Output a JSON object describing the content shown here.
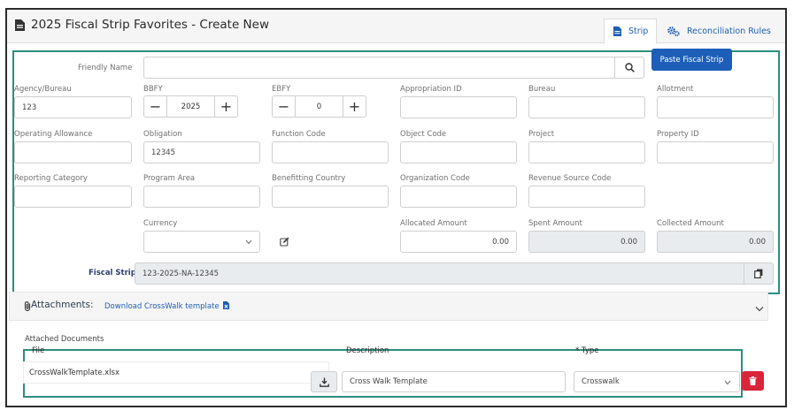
{
  "header": {
    "title": "2025 Fiscal Strip Favorites - Create New",
    "tabs": [
      {
        "label": "Strip",
        "icon": "document-icon",
        "active": true
      },
      {
        "label": "Reconciliation Rules",
        "icon": "gears-icon",
        "active": false
      }
    ]
  },
  "form": {
    "friendly_name": {
      "label": "Friendly Name",
      "value": ""
    },
    "paste_label": "Paste Fiscal Strip",
    "fields": {
      "agency_bureau": {
        "label": "Agency/Bureau",
        "value": "123"
      },
      "bbfy": {
        "label": "BBFY",
        "value": "2025"
      },
      "ebfy": {
        "label": "EBFY",
        "value": "0"
      },
      "appropriation_id": {
        "label": "Appropriation ID",
        "value": ""
      },
      "bureau": {
        "label": "Bureau",
        "value": ""
      },
      "allotment": {
        "label": "Allotment",
        "value": ""
      },
      "operating_allowance": {
        "label": "Operating Allowance",
        "value": ""
      },
      "obligation": {
        "label": "Obligation",
        "value": "12345"
      },
      "function_code": {
        "label": "Function Code",
        "value": ""
      },
      "object_code": {
        "label": "Object Code",
        "value": ""
      },
      "project": {
        "label": "Project",
        "value": ""
      },
      "property_id": {
        "label": "Property ID",
        "value": ""
      },
      "reporting_category": {
        "label": "Reporting Category",
        "value": ""
      },
      "program_area": {
        "label": "Program Area",
        "value": ""
      },
      "benefitting_country": {
        "label": "Benefitting Country",
        "value": ""
      },
      "organization_code": {
        "label": "Organization Code",
        "value": ""
      },
      "revenue_source_code": {
        "label": "Revenue Source Code",
        "value": ""
      },
      "currency": {
        "label": "Currency",
        "value": ""
      },
      "allocated_amount": {
        "label": "Allocated Amount",
        "value": "0.00"
      },
      "spent_amount": {
        "label": "Spent Amount",
        "value": "0.00"
      },
      "collected_amount": {
        "label": "Collected Amount",
        "value": "0.00"
      }
    },
    "fiscal_strip": {
      "label": "Fiscal Strip",
      "value": "123-2025-NA-12345"
    }
  },
  "attachments": {
    "title": "Attachments:",
    "download_link": "Download CrossWalk template",
    "attached_label": "Attached Documents",
    "columns": {
      "file": "File",
      "description": "Description",
      "type": "* Type"
    },
    "rows": [
      {
        "file": "CrossWalkTemplate.xlsx",
        "description": "Cross Walk Template",
        "type": "Crosswalk"
      }
    ]
  },
  "colors": {
    "accent": "#1d5fb8",
    "frame_outline": "#2c8f7c",
    "danger": "#d9243a"
  }
}
